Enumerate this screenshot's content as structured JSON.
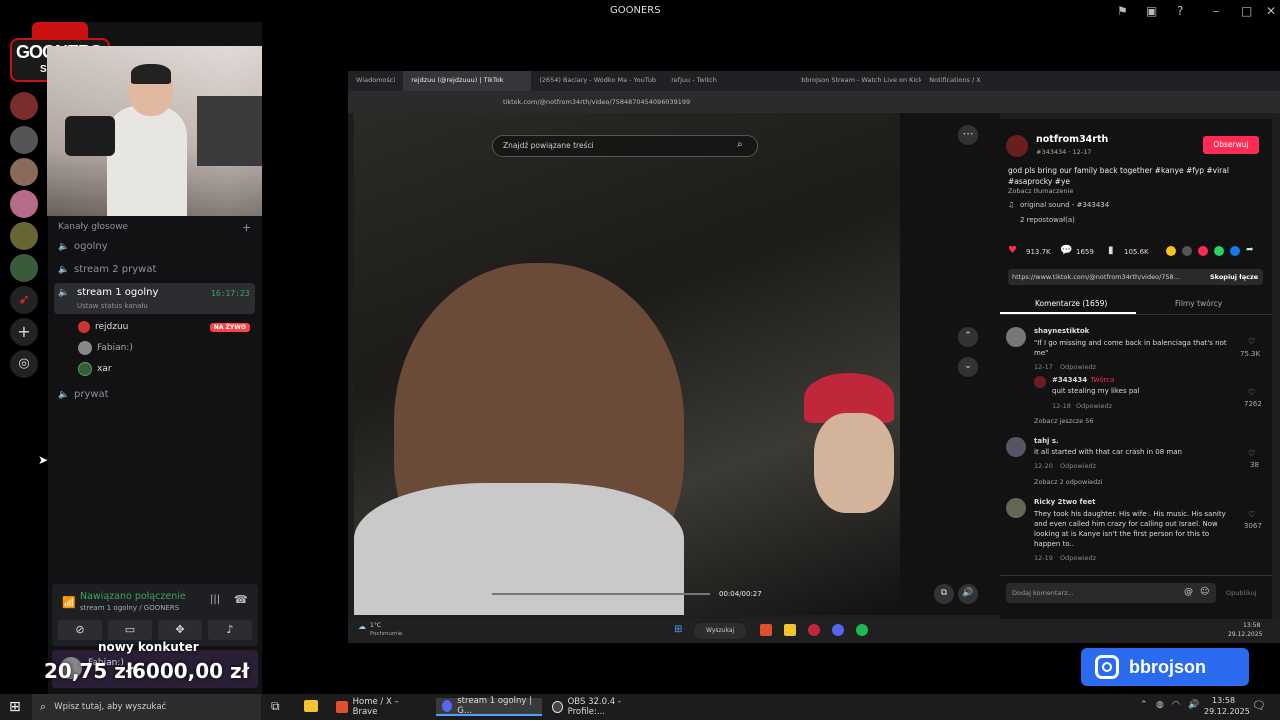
{
  "window": {
    "title": "GOONERS"
  },
  "server": {
    "name": "GOONERS",
    "logo_line1": "GOONERS",
    "logo_line2": "SQUAD"
  },
  "voice_section": {
    "label": "Kanały głosowe"
  },
  "voice_channels": [
    {
      "name": "ogolny"
    },
    {
      "name": "stream 2 prywat"
    },
    {
      "name": "stream 1 ogolny",
      "time": "16:17:23",
      "status": "Ustaw status kanału"
    },
    {
      "name": "prywat"
    }
  ],
  "members": [
    {
      "name": "rejdzuu",
      "badge": "NA ŻYWO"
    },
    {
      "name": "Fabian:)"
    },
    {
      "name": "xar"
    }
  ],
  "connection": {
    "status": "Nawiązano połączenie",
    "channel": "stream 1 ogolny / GOONERS"
  },
  "overlay": {
    "label": "nowy konkuter",
    "user": "Fabian:)",
    "amount1": "20,75 zł",
    "amount2": "6000,00 zł"
  },
  "browser": {
    "tabs": [
      "Wiadomości",
      "rejdzuu (@rejdzuuu) | TikTok",
      "(2654) Baciary - Wódko Ma - YouTub",
      "refjuu - Twitch",
      "bbrojson Stream - Watch Live on Kick",
      "Notifications / X"
    ],
    "url": "tiktok.com/@notfrom34rth/video/7584870454096039199",
    "search_placeholder": "Znajdź powiązane treści",
    "video_time": "00:04/00:27"
  },
  "tiktok": {
    "author": "notfrom34rth",
    "author_sub": "#343434 · 12-17",
    "follow": "Obserwuj",
    "caption": "god pls bring our family back together #kanye #fyp #viral #asaprocky #ye",
    "translate": "Zobacz tłumaczenie",
    "sound": "original sound - #343434",
    "reposted": "2 repostował(a)",
    "likes": "913.7K",
    "comments_count": "1659",
    "saves": "105.6K",
    "link": "https://www.tiktok.com/@notfrom34rth/video/758...",
    "copy_link": "Skopiuj łącze",
    "tab_comments": "Komentarze (1659)",
    "tab_creator": "Filmy twórcy",
    "comments": [
      {
        "user": "shaynestiktok",
        "text": "\"If I go missing and come back in balenciaga that's not me\"",
        "date": "12-17",
        "reply": "Odpowiedz",
        "likes": "75.3K"
      },
      {
        "user": "#343434",
        "tag": "· Twórca",
        "text": "quit stealing my likes pal",
        "date": "12-18",
        "reply": "Odpowiedz",
        "likes": "7262"
      },
      {
        "user": "tahj s.",
        "text": "it all started with that car crash in 08 man",
        "date": "12-20",
        "reply": "Odpowiedz",
        "likes": "38"
      },
      {
        "user": "Ricky 2two feet",
        "text": "They took his daughter. His wife . His music. His sanity and even called him crazy for calling out Israel. Now looking at is Kanye isn't the first person for this to happen to..",
        "date": "12-19",
        "reply": "Odpowiedz",
        "likes": "3067"
      }
    ],
    "more1": "Zobacz jeszcze 56",
    "more2": "Zobacz 2 odpowiedzi",
    "add_comment": "Dodaj komentarz...",
    "publish": "Opublikuj"
  },
  "inner_taskbar": {
    "weather": "1°C",
    "weather_sub": "Pochmurnie",
    "search": "Wyszukaj",
    "time": "13:58",
    "date": "29.12.2025"
  },
  "taskbar": {
    "search": "Wpisz tutaj, aby wyszukać",
    "apps": [
      "Home / X – Brave",
      "stream 1 ogolny | G...",
      "OBS 32.0.4 - Profile:..."
    ],
    "time": "13:58",
    "date": "29.12.2025"
  },
  "instagram": {
    "handle": "bbrojson"
  }
}
